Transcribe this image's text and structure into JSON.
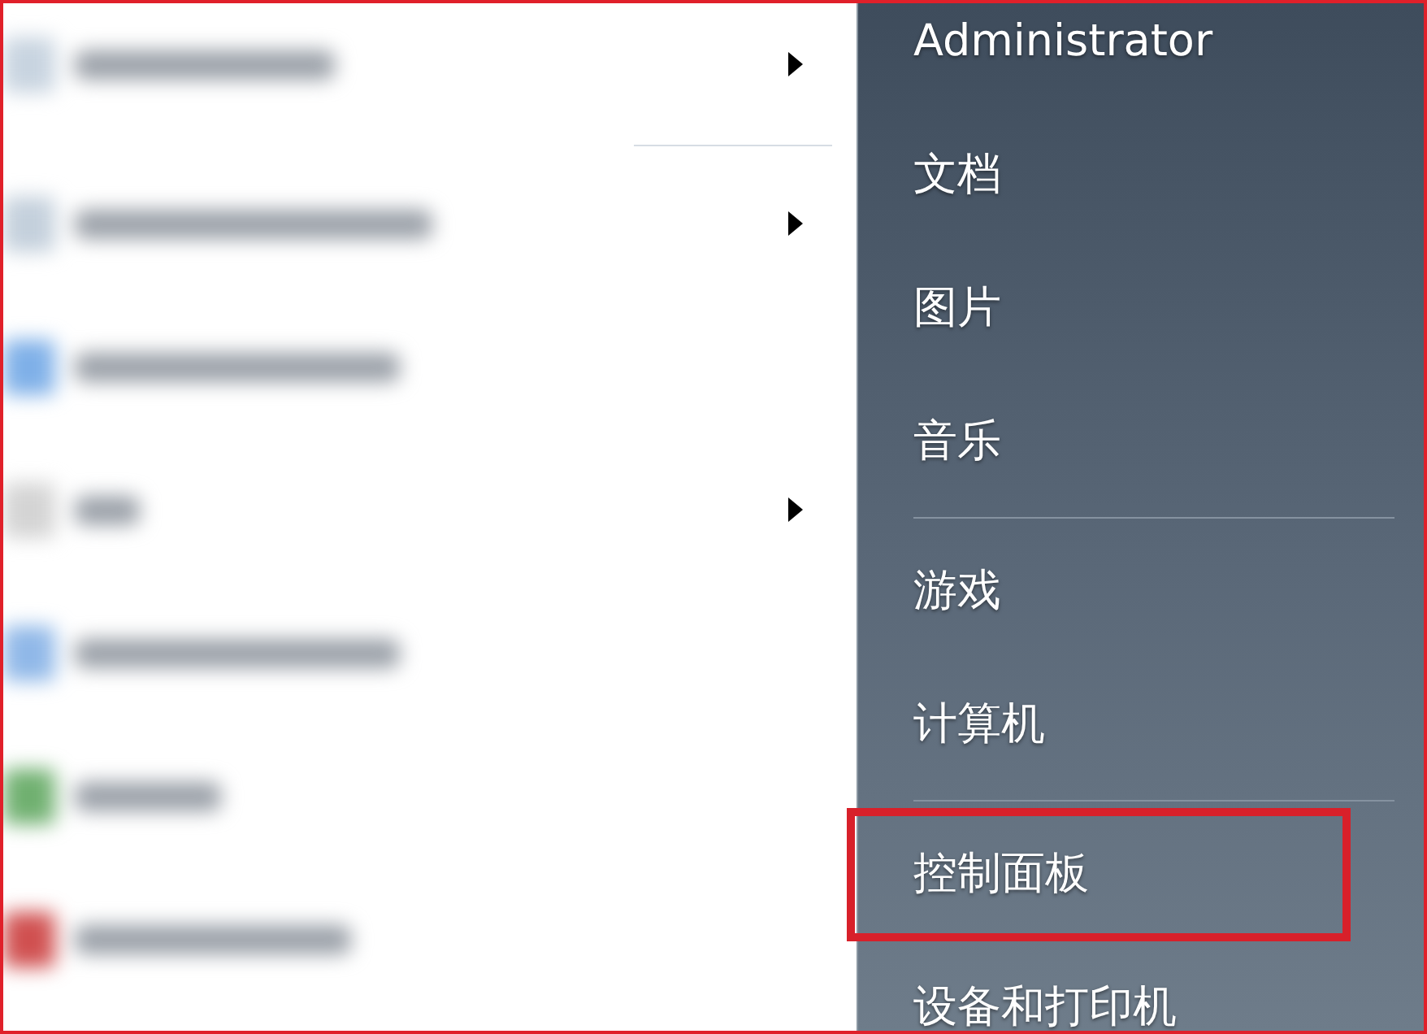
{
  "left_pane": {
    "items": [
      {
        "color": "#c8d4e0",
        "submenu": true,
        "separator_after": true
      },
      {
        "color": "#c4d0dc",
        "submenu": true,
        "separator_after": false
      },
      {
        "color": "#7fb0e8",
        "submenu": false,
        "separator_after": false
      },
      {
        "color": "#d4d4d4",
        "submenu": true,
        "separator_after": false
      },
      {
        "color": "#90b8e8",
        "submenu": false,
        "separator_after": false
      },
      {
        "color": "#70b070",
        "submenu": false,
        "separator_after": false
      },
      {
        "color": "#d05050",
        "submenu": false,
        "separator_after": false
      }
    ]
  },
  "right_pane": {
    "items": [
      {
        "label": "Administrator",
        "highlighted": false,
        "separator_after": false
      },
      {
        "label": "文档",
        "highlighted": false,
        "separator_after": false
      },
      {
        "label": "图片",
        "highlighted": false,
        "separator_after": false
      },
      {
        "label": "音乐",
        "highlighted": false,
        "separator_after": true
      },
      {
        "label": "游戏",
        "highlighted": false,
        "separator_after": false
      },
      {
        "label": "计算机",
        "highlighted": false,
        "separator_after": true
      },
      {
        "label": "控制面板",
        "highlighted": true,
        "separator_after": false
      },
      {
        "label": "设备和打印机",
        "highlighted": false,
        "separator_after": false
      }
    ]
  }
}
